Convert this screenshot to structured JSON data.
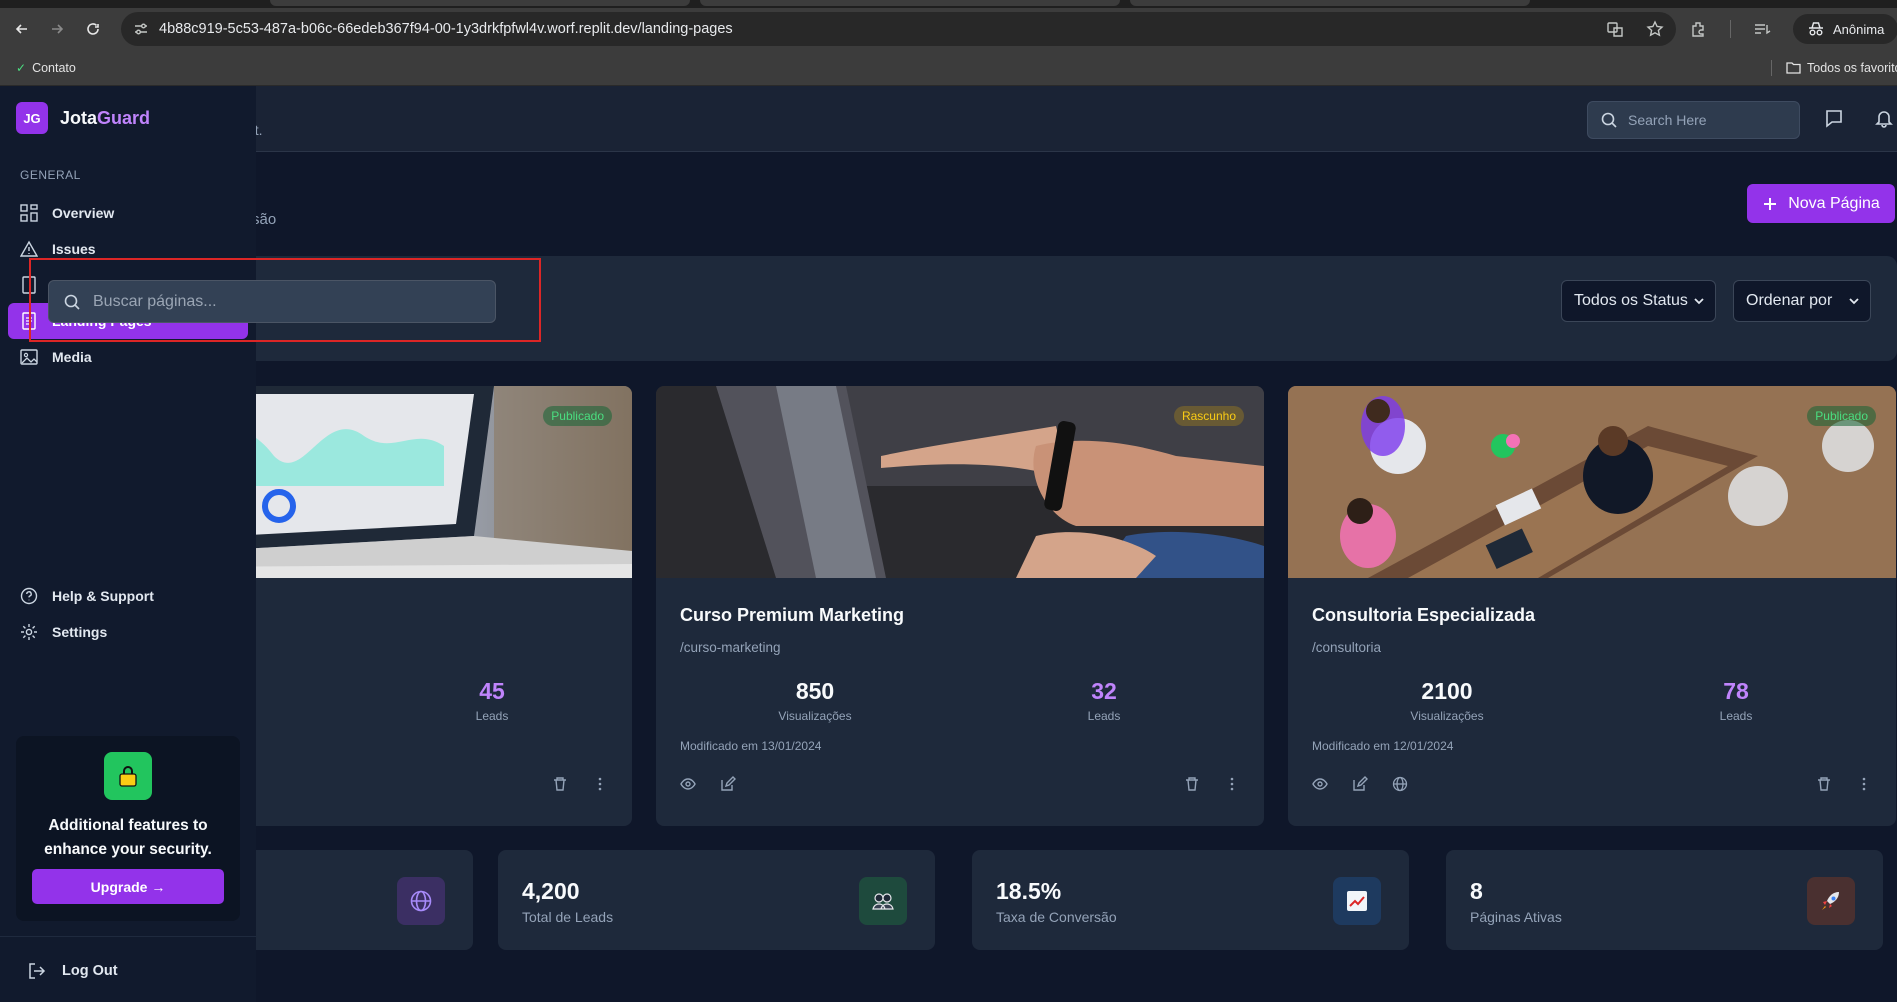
{
  "browser": {
    "url": "4b88c919-5c53-487a-b06c-66edeb367f94-00-1y3drkfpfwl4v.worf.replit.dev/landing-pages",
    "profile_label": "Anônima",
    "bookmark_left": "Contato",
    "bookmark_right": "Todos os favoritos"
  },
  "header": {
    "subtitle_fragment": "uct.",
    "search_placeholder": "Search Here"
  },
  "page": {
    "subtitle_fragment": "são",
    "new_page_label": "Nova Página"
  },
  "filters": {
    "search_placeholder": "Buscar páginas...",
    "status_select": "Todos os Status",
    "sort_select": "Ordenar por"
  },
  "cards": [
    {
      "badge": "Publicado",
      "badge_type": "pub",
      "leads": "45",
      "leads_label": "Leads"
    },
    {
      "badge": "Rascunho",
      "badge_type": "draft",
      "title": "Curso Premium Marketing",
      "slug": "/curso-marketing",
      "views": "850",
      "views_label": "Visualizações",
      "leads": "32",
      "leads_label": "Leads",
      "modified": "Modificado em 13/01/2024"
    },
    {
      "badge": "Publicado",
      "badge_type": "pub",
      "title": "Consultoria Especializada",
      "slug": "/consultoria",
      "views": "2100",
      "views_label": "Visualizações",
      "leads": "78",
      "leads_label": "Leads",
      "modified": "Modificado em 12/01/2024"
    }
  ],
  "stats": [
    {
      "icon": "globe-icon",
      "color": "#3b2f63"
    },
    {
      "value": "4,200",
      "label": "Total de Leads",
      "icon": "users-icon",
      "color": "#1e4a3d"
    },
    {
      "value": "18.5%",
      "label": "Taxa de Conversão",
      "icon": "chart-up-icon",
      "color": "#1e3a5f"
    },
    {
      "value": "8",
      "label": "Páginas Ativas",
      "icon": "rocket-icon",
      "color": "#4a3030"
    }
  ],
  "sidebar": {
    "logo_initials": "JG",
    "brand_a": "Jota",
    "brand_b": "Guard",
    "section_general": "GENERAL",
    "items": [
      {
        "label": "Overview"
      },
      {
        "label": "Issues"
      },
      {
        "label": "Landing Pages"
      },
      {
        "label": "Media"
      },
      {
        "label": "Help & Support"
      },
      {
        "label": "Settings"
      }
    ],
    "promo_text": "Additional features to enhance your security.",
    "upgrade_label": "Upgrade →",
    "logout_label": "Log Out"
  },
  "colors": {
    "accent": "#9333ea",
    "published": "#4ade80",
    "draft": "#facc15",
    "leads_value": "#c084fc"
  }
}
